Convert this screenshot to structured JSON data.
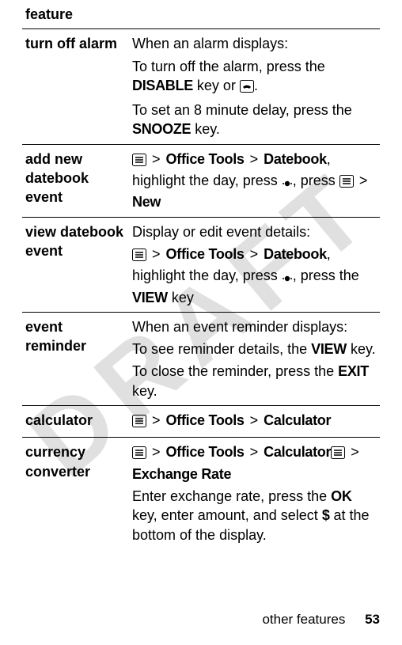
{
  "watermark": "DRAFT",
  "header": {
    "feature": "feature"
  },
  "rows": {
    "turn_off_alarm": {
      "label": "turn off alarm",
      "line1": "When an alarm displays:",
      "line2a": "To turn off the alarm, press the ",
      "disable": "DISABLE",
      "line2b": " key or ",
      "line2c": ".",
      "line3a": "To set an 8 minute delay, press the ",
      "snooze": "SNOOZE",
      "line3b": " key."
    },
    "add_event": {
      "label": "add new datebook event",
      "gt": ">",
      "office_tools": "Office Tools",
      "datebook": "Datebook",
      "part2a": ", highlight the day, press ",
      "part2b": ", press ",
      "new": "New"
    },
    "view_event": {
      "label": "view datebook event",
      "line1": "Display or edit event details:",
      "gt": ">",
      "office_tools": "Office Tools",
      "datebook": "Datebook",
      "part2a": ", highlight the day, press ",
      "part2b": ", press the ",
      "view": "VIEW",
      "part2c": " key"
    },
    "event_reminder": {
      "label": "event reminder",
      "line1": "When an event reminder displays:",
      "line2a": "To see reminder details, the ",
      "view": "VIEW",
      "line2b": " key.",
      "line3a": "To close the reminder, press the ",
      "exit": "EXIT",
      "line3b": " key."
    },
    "calculator": {
      "label": "calculator",
      "gt": ">",
      "office_tools": "Office Tools",
      "calculator": "Calculator"
    },
    "currency": {
      "label": "currency converter",
      "gt": ">",
      "office_tools": "Office Tools",
      "calculator": "Calculator",
      "exchange_rate": "Exchange Rate",
      "line2a": "Enter exchange rate, press the ",
      "ok": "OK",
      "line2b": " key, enter amount, and select ",
      "dollar": "$",
      "line2c": " at the bottom of the display."
    }
  },
  "footer": {
    "section": "other features",
    "page": "53"
  }
}
